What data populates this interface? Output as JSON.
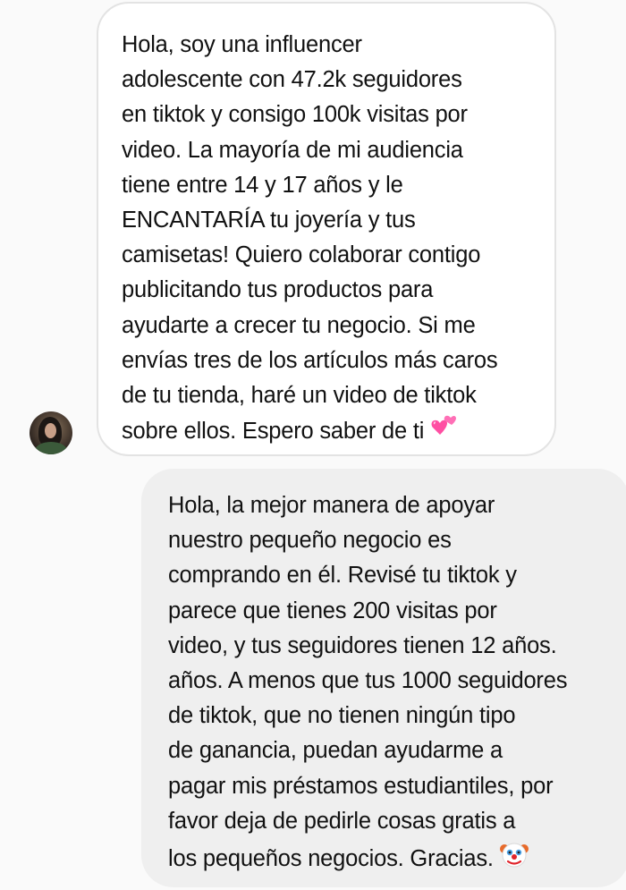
{
  "messages": [
    {
      "direction": "incoming",
      "lines": [
        "Hola, soy una influencer",
        "adolescente con 47.2k seguidores",
        "en tiktok y consigo 100k visitas por",
        "video. La mayoría de mi audiencia",
        "tiene entre 14 y 17 años y le",
        "ENCANTARÍA tu joyería y tus",
        "camisetas! Quiero colaborar contigo",
        "publicitando tus productos para",
        "ayudarte a crecer tu negocio. Si me",
        "envías tres de los artículos más caros",
        "de tu tienda, haré un video de tiktok",
        "sobre ellos. Espero saber de ti"
      ],
      "trailing_emoji": "two-hearts-emoji"
    },
    {
      "direction": "outgoing",
      "lines": [
        "Hola, la mejor manera de apoyar",
        "nuestro pequeño negocio es",
        "comprando en él. Revisé tu tiktok y",
        "parece que tienes 200 visitas por",
        "video, y tus seguidores tienen 12 años.",
        "años. A menos que tus 1000 seguidores",
        "de tiktok, que no tienen ningún tipo",
        "de ganancia, puedan ayudarme a",
        "pagar mis préstamos estudiantiles, por",
        "favor deja de pedirle cosas gratis a",
        "los pequeños negocios. Gracias."
      ],
      "trailing_emoji": "clown-face-emoji"
    }
  ],
  "colors": {
    "background": "#fafafa",
    "incoming_bubble": "#ffffff",
    "incoming_border": "#e3e3e3",
    "outgoing_bubble": "#efefef",
    "text": "#111111",
    "heart_pink": "#ff4fa3",
    "clown_face": "#ffffff",
    "clown_nose": "#e0242b",
    "clown_hair": "#e86a2a"
  }
}
